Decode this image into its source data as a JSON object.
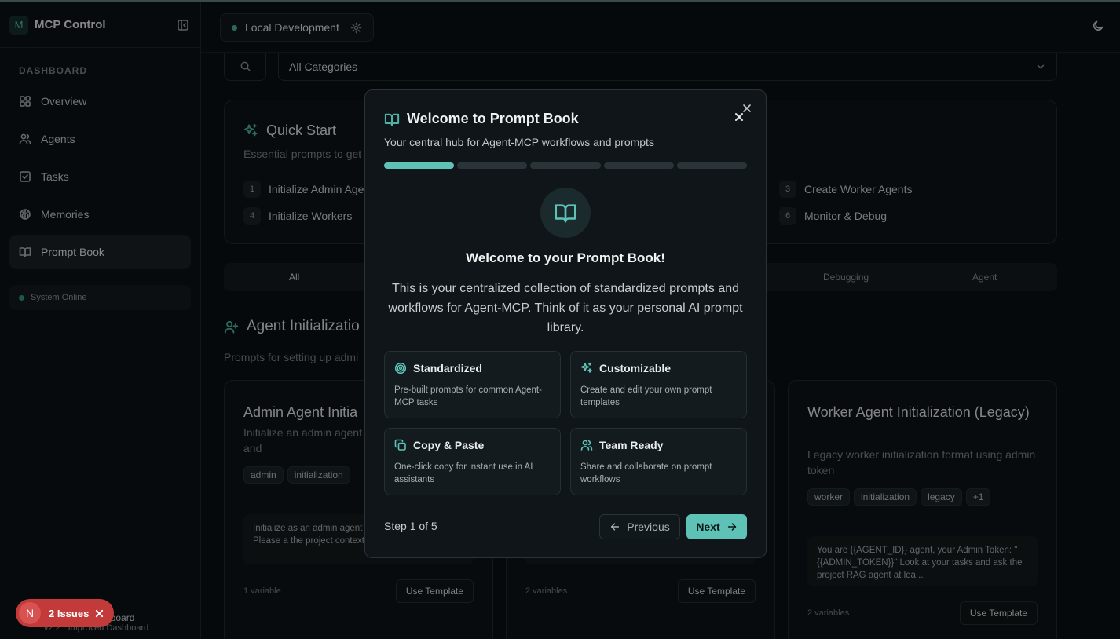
{
  "sidebar": {
    "logo_letter": "M",
    "app_name": "MCP Control",
    "section_label": "DASHBOARD",
    "items": [
      {
        "label": "Overview",
        "icon": "grid-icon"
      },
      {
        "label": "Agents",
        "icon": "users-icon"
      },
      {
        "label": "Tasks",
        "icon": "checkbox-icon"
      },
      {
        "label": "Memories",
        "icon": "brain-icon"
      },
      {
        "label": "Prompt Book",
        "icon": "book-icon",
        "active": true
      }
    ],
    "status": "System Online",
    "footer_title": "shboard",
    "footer_sub": "v2.2 · Improved Dashboard"
  },
  "topbar": {
    "environment": "Local Development"
  },
  "filters": {
    "category": "All Categories"
  },
  "quick_start": {
    "title": "Quick Start",
    "subtitle": "Essential prompts to get",
    "steps": [
      {
        "num": "1",
        "label": "Initialize Admin Age"
      },
      {
        "num": "3",
        "label": "Create Worker Agents"
      },
      {
        "num": "4",
        "label": "Initialize Workers"
      },
      {
        "num": "6",
        "label": "Monitor & Debug"
      }
    ]
  },
  "tabs": [
    "All",
    "Debugging",
    "Agent"
  ],
  "section": {
    "title": "Agent Initializatio",
    "subtitle": "Prompts for setting up admi"
  },
  "cards": [
    {
      "title": "Admin Agent Initia",
      "desc": "Initialize an admin agent authentication token and",
      "tags": [
        "admin",
        "initialization"
      ],
      "preview": "Initialize as an admin agent {{ADMIN_TOKEN}} Please a the project context. Don't",
      "variables": "1 variable",
      "button": "Use Template"
    },
    {
      "title": "",
      "desc": "",
      "tags": [],
      "preview": "",
      "variables": "2 variables",
      "button": "Use Template"
    },
    {
      "title": "Worker Agent Initialization (Legacy)",
      "desc": "Legacy worker initialization format using admin token",
      "tags": [
        "worker",
        "initialization",
        "legacy",
        "+1"
      ],
      "preview": "You are {{AGENT_ID}} agent, your Admin Token: \"{{ADMIN_TOKEN}}\" Look at your tasks and ask the project RAG agent at lea...",
      "variables": "2 variables",
      "button": "Use Template"
    }
  ],
  "modal": {
    "title": "Welcome to Prompt Book",
    "subtitle": "Your central hub for Agent-MCP workflows and prompts",
    "progress": {
      "current": 1,
      "total": 5
    },
    "heading": "Welcome to your Prompt Book!",
    "body": "This is your centralized collection of standardized prompts and workflows for Agent-MCP. Think of it as your personal AI prompt library.",
    "features": [
      {
        "title": "Standardized",
        "desc": "Pre-built prompts for common Agent-MCP tasks",
        "icon": "target-icon"
      },
      {
        "title": "Customizable",
        "desc": "Create and edit your own prompt templates",
        "icon": "sparkles-icon"
      },
      {
        "title": "Copy & Paste",
        "desc": "One-click copy for instant use in AI assistants",
        "icon": "copy-icon"
      },
      {
        "title": "Team Ready",
        "desc": "Share and collaborate on prompt workflows",
        "icon": "users-icon"
      }
    ],
    "step_text": "Step 1 of 5",
    "prev_label": "Previous",
    "next_label": "Next"
  },
  "issues_badge": {
    "letter": "N",
    "label": "2 Issues"
  },
  "colors": {
    "accent": "#5ec2b7",
    "background": "#0b1013",
    "issue_red": "#c23a3a"
  }
}
